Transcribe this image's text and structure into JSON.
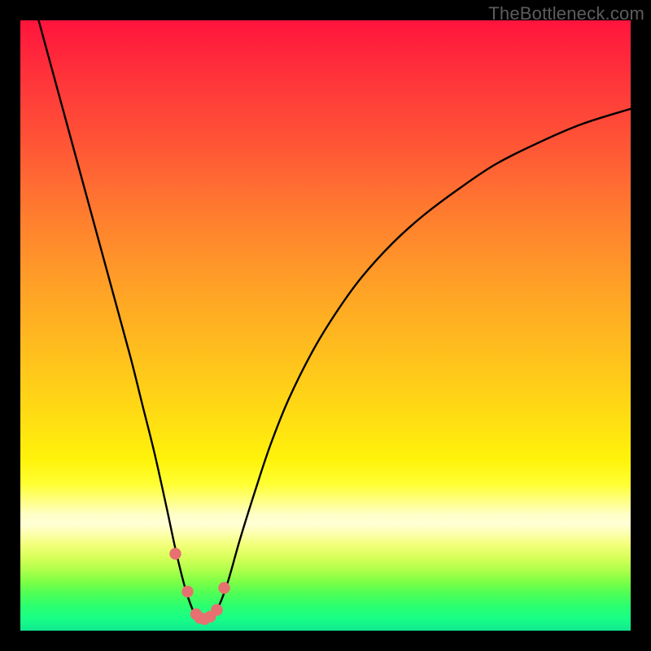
{
  "watermark": "TheBottleneck.com",
  "colors": {
    "gradient_top": "#ff143c",
    "gradient_mid": "#ffe012",
    "gradient_bottom": "#12e890",
    "curve": "#000000",
    "markers": "#e77070",
    "background": "#000000"
  },
  "chart_data": {
    "type": "line",
    "title": "",
    "xlabel": "",
    "ylabel": "",
    "xlim": [
      0,
      100
    ],
    "ylim": [
      0,
      100
    ],
    "x": [
      3,
      6,
      9,
      12,
      15,
      18,
      20,
      22,
      24,
      25.5,
      27,
      28.2,
      29,
      30,
      31.2,
      32.5,
      34,
      36,
      38.5,
      41,
      44,
      48,
      52,
      56,
      61,
      66,
      72,
      78,
      85,
      92,
      100
    ],
    "values": [
      100,
      89,
      78,
      67,
      56,
      45,
      37,
      29,
      20,
      13,
      7,
      3.5,
      2,
      1.8,
      2.2,
      4,
      8,
      15,
      23,
      30.5,
      38,
      46,
      52.5,
      58,
      63.5,
      68,
      72.5,
      76.5,
      80,
      83,
      85.5
    ],
    "markers": {
      "x": [
        25.4,
        27.4,
        28.8,
        29.4,
        30.2,
        31.1,
        32.2,
        33.4
      ],
      "y": [
        12.6,
        6.4,
        2.7,
        2.1,
        1.9,
        2.3,
        3.4,
        7.0
      ]
    },
    "note": "x and y are percentages of the plot area; y=0 at bottom, y=100 at top. Curve shows a sharp minimum near x≈30."
  }
}
